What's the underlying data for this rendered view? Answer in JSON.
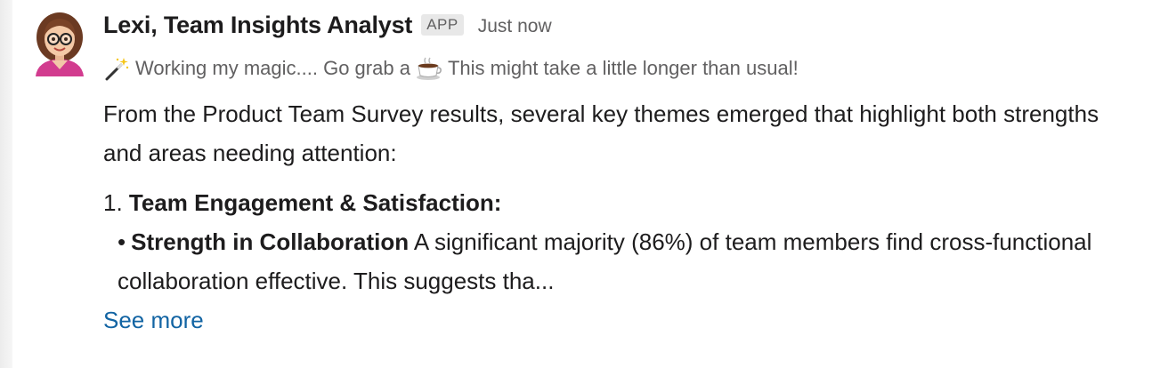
{
  "message": {
    "sender_name": "Lexi, Team Insights Analyst",
    "badge": "APP",
    "timestamp": "Just now",
    "status": {
      "before_coffee": "Working my magic.... Go grab a",
      "after_coffee": "This might take a little longer than usual!"
    },
    "body": {
      "intro": "From the Product Team Survey results, several key themes emerged that highlight both strengths and areas needing attention:",
      "item_number": "1.",
      "item_title": "Team Engagement & Satisfaction:",
      "bullet_char": "•",
      "bullet_title": "Strength in Collaboration",
      "bullet_text": " A significant majority (86%) of team members find cross-functional collaboration effective. This suggests tha..."
    },
    "see_more": "See more"
  },
  "colors": {
    "link": "#1264a3",
    "muted": "#616061",
    "text": "#1d1c1d"
  },
  "icons": [
    "avatar-icon",
    "magic-wand-icon",
    "coffee-icon"
  ]
}
